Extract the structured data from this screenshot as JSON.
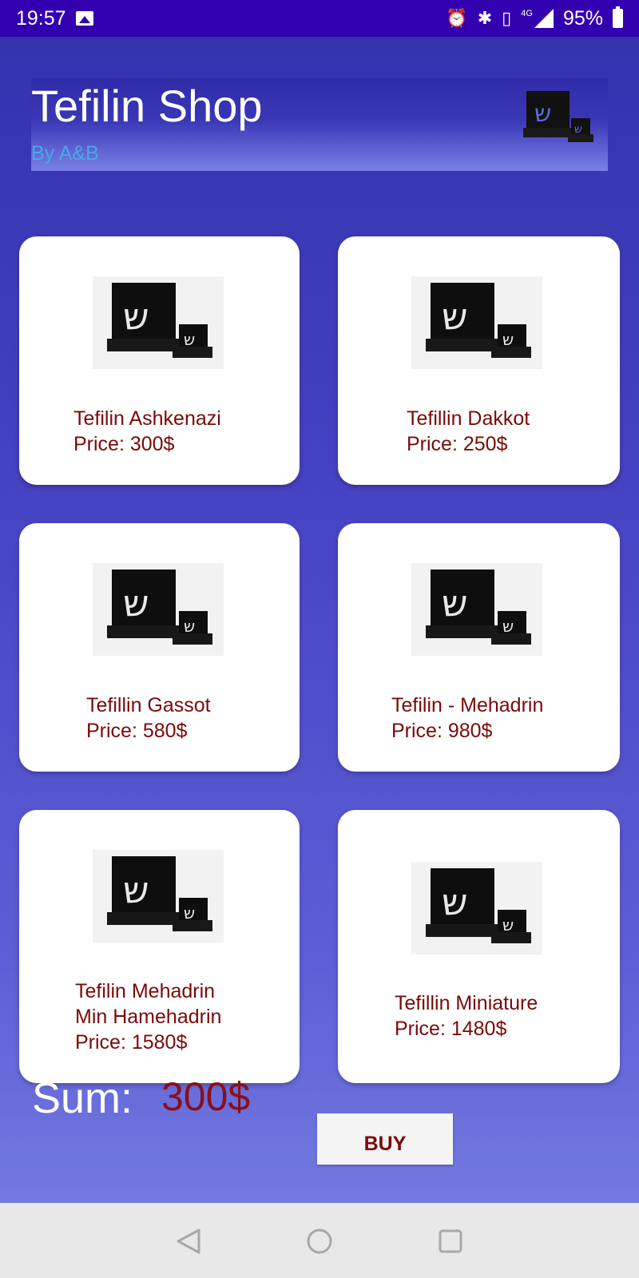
{
  "status_bar": {
    "time": "19:57",
    "network": "4G",
    "battery": "95%",
    "icons": [
      "image-icon",
      "alarm-icon",
      "bluetooth-icon",
      "vibrate-icon",
      "signal-icon",
      "battery-icon"
    ]
  },
  "header": {
    "title": "Tefilin Shop",
    "subtitle": "By A&B",
    "logo_icon": "tefilin-logo"
  },
  "products": [
    {
      "name": "Tefilin Ashkenazi",
      "price": "Price: 300$"
    },
    {
      "name": "Tefillin Dakkot",
      "price": "Price: 250$"
    },
    {
      "name": "Tefillin Gassot",
      "price": "Price: 580$"
    },
    {
      "name": "Tefilin - Mehadrin",
      "price": "Price: 980$"
    },
    {
      "name": "Tefilin Mehadrin",
      "name_line2": "Min Hamehadrin",
      "price": "Price: 1580$"
    },
    {
      "name": "Tefillin Miniature",
      "price": "Price: 1480$"
    }
  ],
  "footer": {
    "sum_label": "Sum:",
    "sum_value": "300$",
    "buy_label": "BUY"
  },
  "nav_bar": {
    "icons": [
      "back-icon",
      "home-icon",
      "recents-icon"
    ]
  },
  "colors": {
    "status_bar": "#3300b0",
    "text_dark_red": "#7a0a0a",
    "subtitle_blue": "#4aa8e8"
  }
}
